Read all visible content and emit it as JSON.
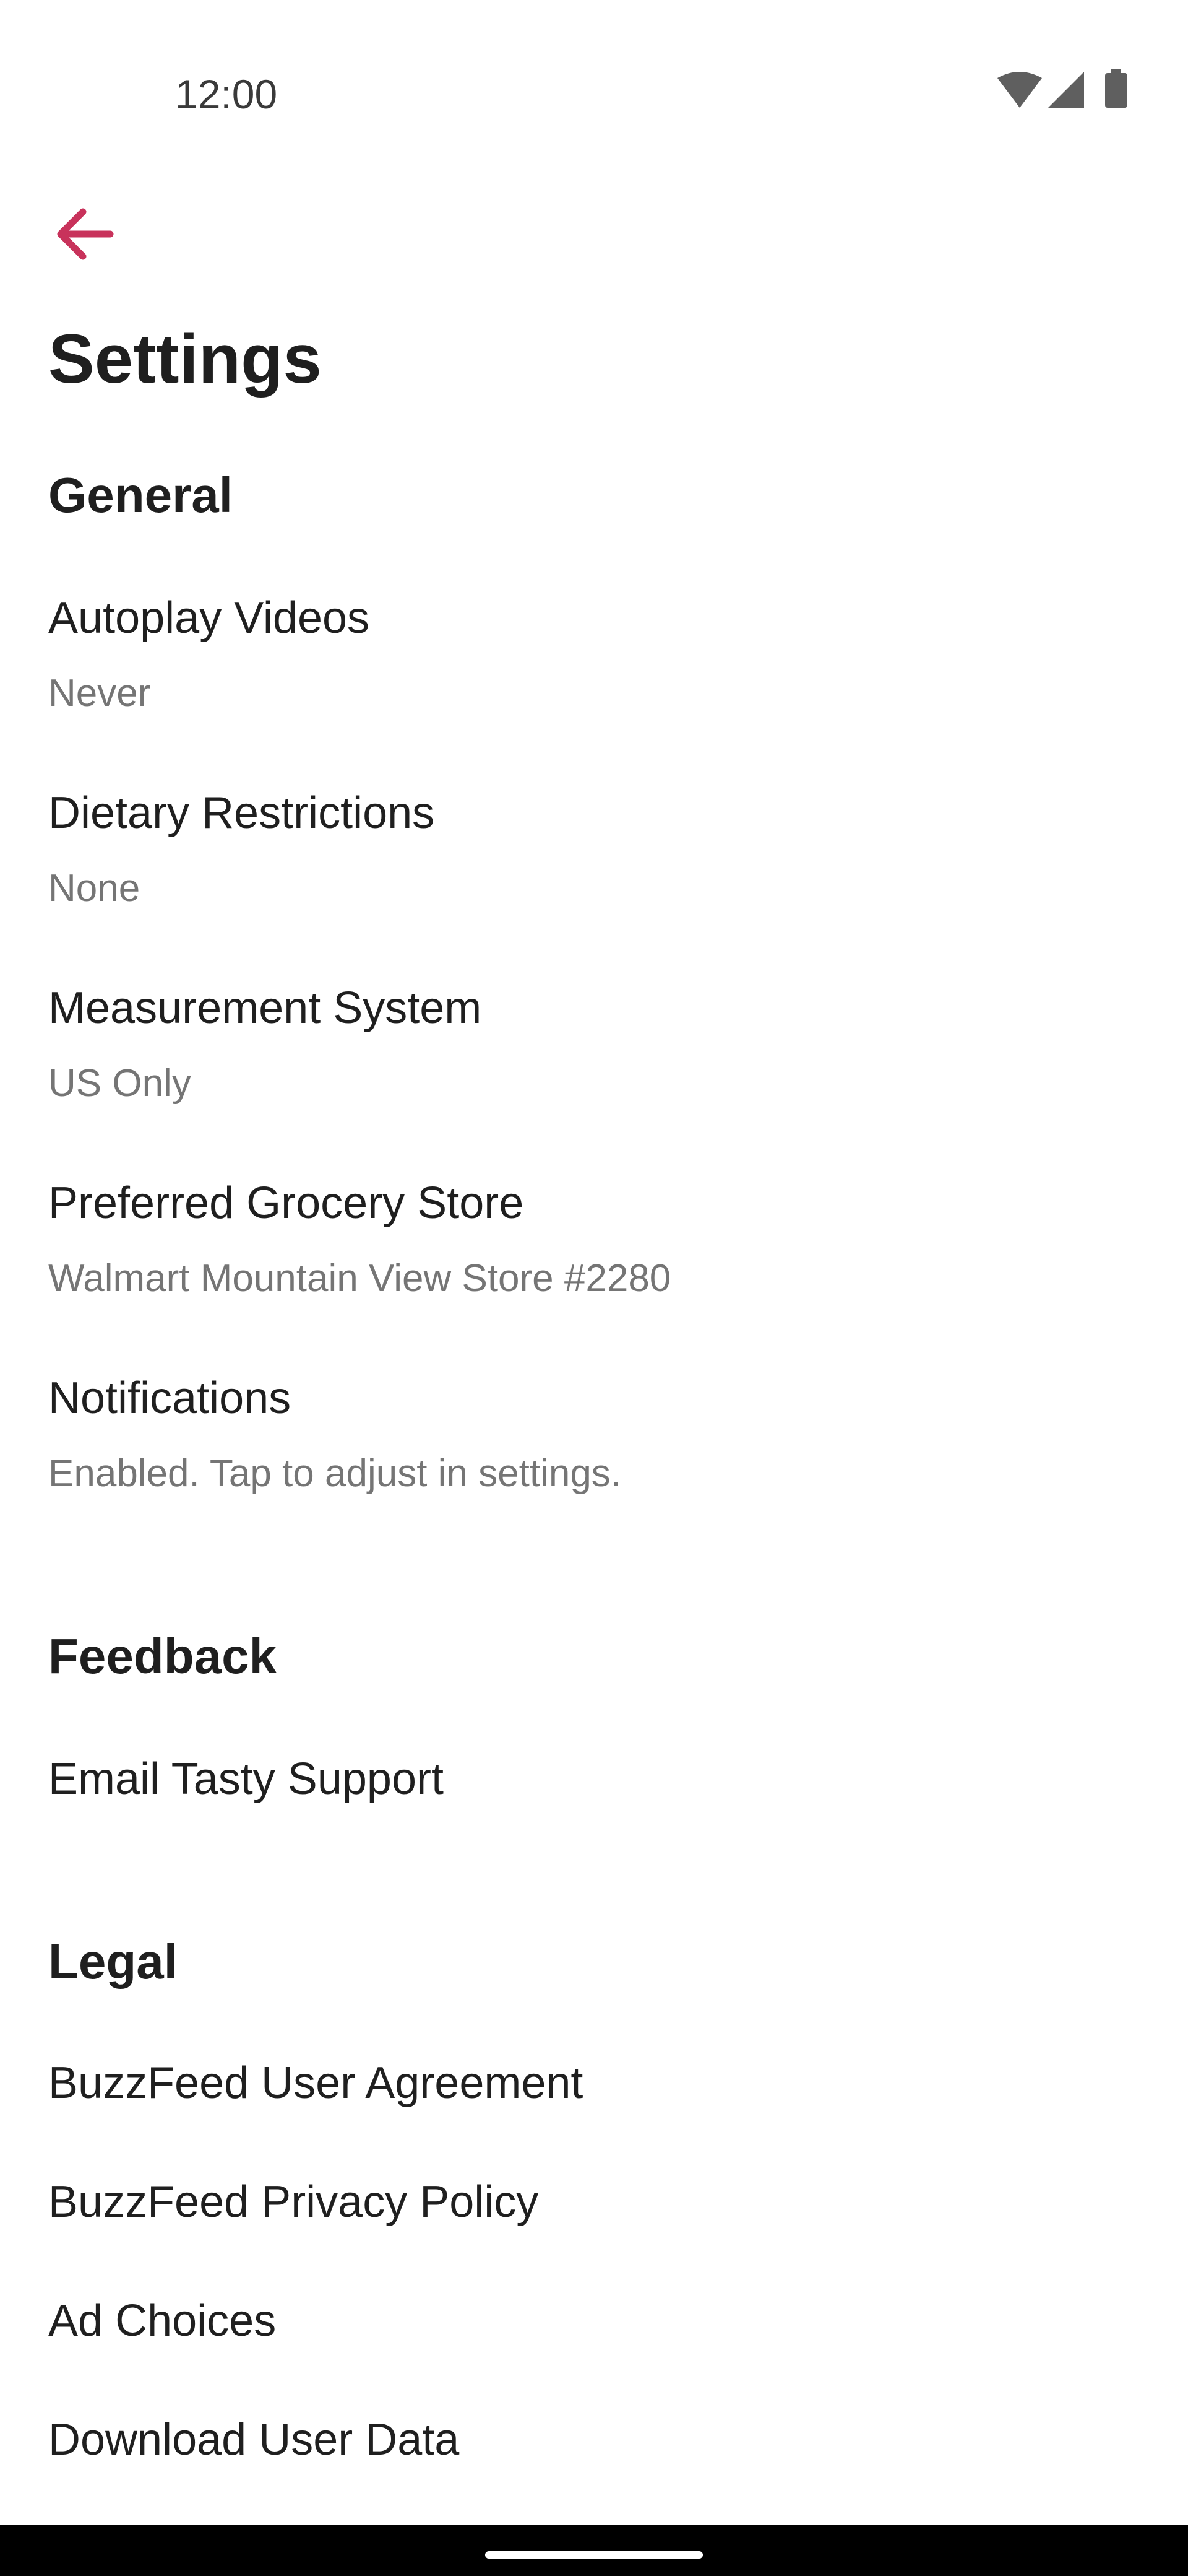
{
  "status_bar": {
    "time": "12:00",
    "icons": [
      "wifi-icon",
      "signal-icon",
      "battery-icon"
    ]
  },
  "header": {
    "back_icon": "arrow-left-icon",
    "title": "Settings",
    "accent_color": "#c8325b"
  },
  "sections": {
    "general": {
      "title": "General",
      "items": [
        {
          "title": "Autoplay Videos",
          "value": "Never"
        },
        {
          "title": "Dietary Restrictions",
          "value": "None"
        },
        {
          "title": "Measurement System",
          "value": "US Only"
        },
        {
          "title": "Preferred Grocery Store",
          "value": "Walmart Mountain View Store #2280"
        },
        {
          "title": "Notifications",
          "value": "Enabled. Tap to adjust in settings."
        }
      ]
    },
    "feedback": {
      "title": "Feedback",
      "items": [
        {
          "title": "Email Tasty Support"
        }
      ]
    },
    "legal": {
      "title": "Legal",
      "items": [
        {
          "title": "BuzzFeed User Agreement"
        },
        {
          "title": "BuzzFeed Privacy Policy"
        },
        {
          "title": "Ad Choices"
        },
        {
          "title": "Download User Data"
        }
      ]
    }
  }
}
